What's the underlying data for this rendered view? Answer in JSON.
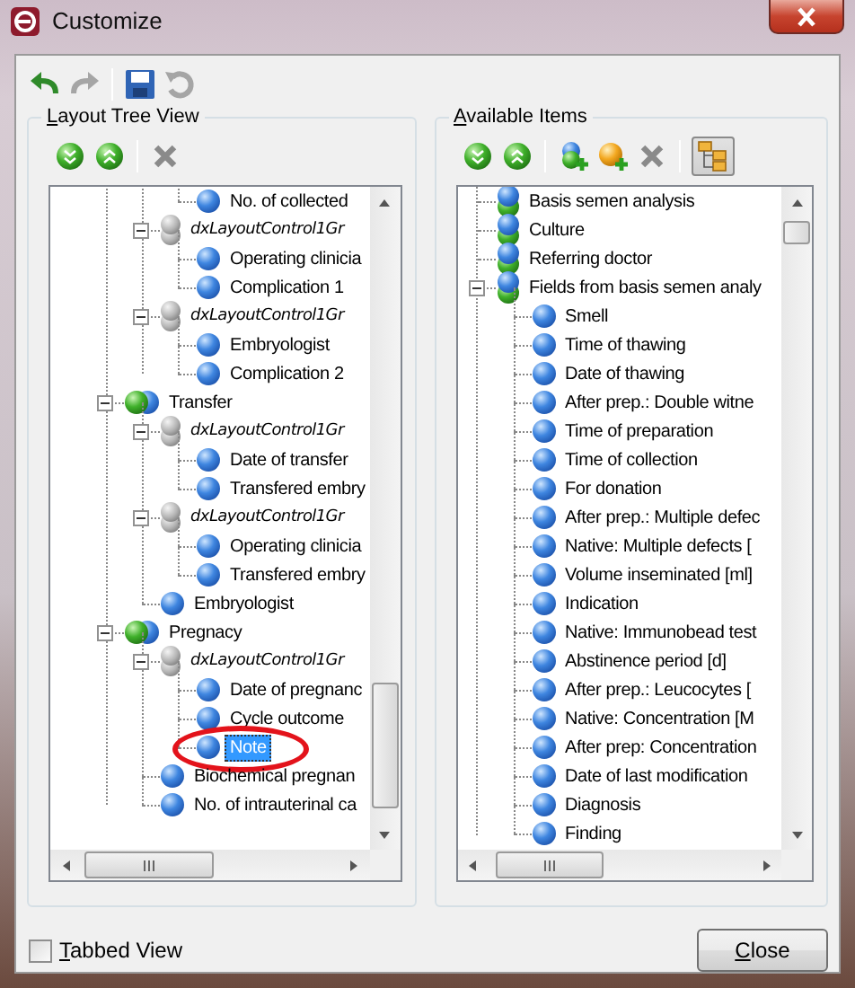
{
  "window": {
    "title": "Customize"
  },
  "toolbar": [
    {
      "kind": "undo",
      "disabled": false
    },
    {
      "kind": "redo",
      "disabled": true
    },
    {
      "kind": "separator"
    },
    {
      "kind": "save",
      "disabled": false
    },
    {
      "kind": "reset",
      "disabled": true
    }
  ],
  "layout_tree": {
    "title": "Layout Tree View",
    "tools": [
      {
        "kind": "expand-all"
      },
      {
        "kind": "collapse-all"
      },
      {
        "kind": "separator"
      },
      {
        "kind": "delete"
      }
    ],
    "nodes": [
      {
        "children": [
          {
            "children": [
              {
                "children": [
                  {
                    "label": "No. of collected",
                    "kind": "item",
                    "selected": false
                  }
                ]
              },
              {
                "label": "dxLayoutControl1Gr",
                "kind": "group",
                "expanded": true,
                "selected": false,
                "children": [
                  {
                    "label": "Operating clinicia",
                    "kind": "item",
                    "selected": false
                  },
                  {
                    "label": "Complication 1",
                    "kind": "item",
                    "selected": false
                  }
                ]
              },
              {
                "label": "dxLayoutControl1Gr",
                "kind": "group",
                "expanded": true,
                "selected": false,
                "children": [
                  {
                    "label": "Embryologist",
                    "kind": "item",
                    "selected": false
                  },
                  {
                    "label": "Complication 2",
                    "kind": "item",
                    "selected": false
                  }
                ]
              }
            ]
          },
          {
            "label": "Transfer",
            "kind": "section",
            "expanded": true,
            "selected": false,
            "children": [
              {
                "label": "dxLayoutControl1Gr",
                "kind": "group",
                "expanded": true,
                "selected": false,
                "children": [
                  {
                    "label": "Date of transfer",
                    "kind": "item",
                    "selected": false
                  },
                  {
                    "label": "Transfered embry",
                    "kind": "item",
                    "selected": false
                  }
                ]
              },
              {
                "label": "dxLayoutControl1Gr",
                "kind": "group",
                "expanded": true,
                "selected": false,
                "children": [
                  {
                    "label": "Operating clinicia",
                    "kind": "item",
                    "selected": false
                  },
                  {
                    "label": "Transfered embry",
                    "kind": "item",
                    "selected": false
                  }
                ]
              },
              {
                "label": "Embryologist",
                "kind": "item",
                "selected": false
              }
            ]
          },
          {
            "label": "Pregnacy",
            "kind": "section",
            "expanded": true,
            "selected": false,
            "children": [
              {
                "label": "dxLayoutControl1Gr",
                "kind": "group",
                "expanded": true,
                "selected": false,
                "children": [
                  {
                    "label": "Date of pregnanc",
                    "kind": "item",
                    "selected": false
                  },
                  {
                    "label": "Cycle outcome",
                    "kind": "item",
                    "selected": false
                  },
                  {
                    "label": "Note",
                    "kind": "item",
                    "selected": true
                  }
                ]
              },
              {
                "label": "Biochemical pregnan",
                "kind": "item",
                "selected": false
              },
              {
                "label": "No. of intrauterinal ca",
                "kind": "item",
                "selected": false
              }
            ]
          }
        ]
      }
    ]
  },
  "available_items": {
    "title": "Available Items",
    "tools": [
      {
        "kind": "expand-all"
      },
      {
        "kind": "collapse-all"
      },
      {
        "kind": "separator"
      },
      {
        "kind": "add-group"
      },
      {
        "kind": "add-item"
      },
      {
        "kind": "delete"
      },
      {
        "kind": "separator"
      },
      {
        "kind": "tree-view",
        "pressed": true
      }
    ],
    "nodes": [
      {
        "label": "Basis semen analysis",
        "kind": "category",
        "selected": false
      },
      {
        "label": "Culture",
        "kind": "category",
        "selected": false
      },
      {
        "label": "Referring doctor",
        "kind": "category",
        "selected": false
      },
      {
        "label": "Fields from basis semen analy",
        "kind": "category",
        "expanded": true,
        "selected": false,
        "children": [
          {
            "label": "Smell",
            "kind": "item",
            "selected": false
          },
          {
            "label": "Time of thawing",
            "kind": "item",
            "selected": false
          },
          {
            "label": "Date of thawing",
            "kind": "item",
            "selected": false
          },
          {
            "label": "After prep.: Double witne",
            "kind": "item",
            "selected": false
          },
          {
            "label": "Time of preparation",
            "kind": "item",
            "selected": false
          },
          {
            "label": "Time of collection",
            "kind": "item",
            "selected": false
          },
          {
            "label": "For donation",
            "kind": "item",
            "selected": false
          },
          {
            "label": "After prep.: Multiple defec",
            "kind": "item",
            "selected": false
          },
          {
            "label": "Native: Multiple defects [",
            "kind": "item",
            "selected": false
          },
          {
            "label": "Volume inseminated [ml]",
            "kind": "item",
            "selected": false
          },
          {
            "label": "Indication",
            "kind": "item",
            "selected": false
          },
          {
            "label": "Native: Immunobead test",
            "kind": "item",
            "selected": false
          },
          {
            "label": "Abstinence period [d]",
            "kind": "item",
            "selected": false
          },
          {
            "label": "After prep.: Leucocytes [",
            "kind": "item",
            "selected": false
          },
          {
            "label": "Native: Concentration [M",
            "kind": "item",
            "selected": false
          },
          {
            "label": "After prep: Concentration",
            "kind": "item",
            "selected": false
          },
          {
            "label": "Date of last modification",
            "kind": "item",
            "selected": false
          },
          {
            "label": "Diagnosis",
            "kind": "item",
            "selected": false
          },
          {
            "label": "Finding",
            "kind": "item",
            "selected": false
          }
        ]
      }
    ]
  },
  "tabbed_view": {
    "label": "Tabbed View",
    "checked": false
  },
  "buttons": [
    {
      "label": "Close"
    }
  ]
}
